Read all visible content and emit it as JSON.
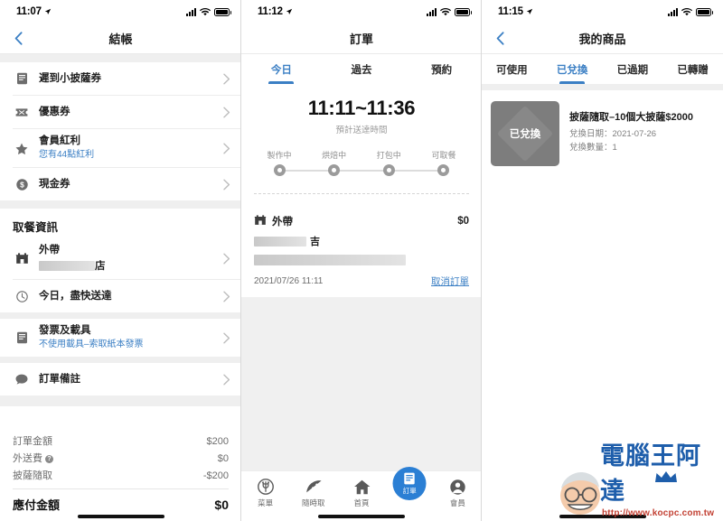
{
  "panel1": {
    "status": {
      "time": "11:07",
      "location_arrow": "location-arrow-icon",
      "signal": "signal-bars-icon",
      "wifi": "wifi-icon",
      "battery": "battery-icon"
    },
    "nav": {
      "back": "chevron-left-icon",
      "title": "結帳"
    },
    "coupons": [
      {
        "icon": "receipt-icon",
        "label": "遲到小披薩券",
        "sub": ""
      },
      {
        "icon": "ticket-icon",
        "label": "優惠券",
        "sub": ""
      },
      {
        "icon": "star-icon",
        "label": "會員紅利",
        "sub": "您有44點紅利"
      },
      {
        "icon": "dollar-circle-icon",
        "label": "現金券",
        "sub": ""
      }
    ],
    "pickup_section_title": "取餐資訊",
    "pickup": [
      {
        "icon": "store-icon",
        "label": "外帶",
        "sub_suffix": "店"
      },
      {
        "icon": "clock-icon",
        "label": "今日，盡快送達",
        "sub": ""
      }
    ],
    "invoice": {
      "icon": "receipt-icon",
      "label": "發票及載具",
      "sub": "不使用載具–索取紙本發票"
    },
    "note": {
      "icon": "comment-icon",
      "label": "訂單備註"
    },
    "totals": [
      {
        "label": "訂單金額",
        "value": "$200",
        "has_help": false
      },
      {
        "label": "外送費",
        "value": "$0",
        "has_help": true
      },
      {
        "label": "披薩隨取",
        "value": "-$200",
        "has_help": false
      }
    ],
    "total_final": {
      "label": "應付金額",
      "value": "$0"
    }
  },
  "panel2": {
    "status": {
      "time": "11:12"
    },
    "nav": {
      "title": "訂單"
    },
    "tabs": [
      {
        "label": "今日",
        "active": true
      },
      {
        "label": "過去",
        "active": false
      },
      {
        "label": "預約",
        "active": false
      }
    ],
    "eta": "11:11~11:36",
    "eta_sub": "預計送達時間",
    "steps": [
      "製作中",
      "烘焙中",
      "打包中",
      "可取餐"
    ],
    "order": {
      "type_icon": "store-icon",
      "type": "外帶",
      "price": "$0",
      "store_suffix": "吉",
      "datetime": "2021/07/26 11:11",
      "cancel_label": "取消訂單"
    },
    "bottom_nav": [
      {
        "icon": "menu-circle-icon",
        "label": "菜單",
        "active": false
      },
      {
        "icon": "pizza-slice-icon",
        "label": "隨時取",
        "active": false
      },
      {
        "icon": "home-icon",
        "label": "首頁",
        "active": false
      },
      {
        "icon": "order-list-icon",
        "label": "訂單",
        "active": true
      },
      {
        "icon": "user-icon",
        "label": "會員",
        "active": false
      }
    ]
  },
  "panel3": {
    "status": {
      "time": "11:15"
    },
    "nav": {
      "back": "chevron-left-icon",
      "title": "我的商品"
    },
    "tabs": [
      {
        "label": "可使用",
        "active": false
      },
      {
        "label": "已兌換",
        "active": true
      },
      {
        "label": "已過期",
        "active": false
      },
      {
        "label": "已轉贈",
        "active": false
      }
    ],
    "product": {
      "badge": "已兌換",
      "title": "披薩隨取–10個大披薩$2000",
      "meta1": "兌換日期：2021-07-26",
      "meta2": "兌換數量：1"
    }
  },
  "watermark": {
    "brand": "電腦王阿達",
    "url": "http://www.kocpc.com.tw"
  },
  "colors": {
    "accent": "#3b7fc4",
    "fab": "#2b7fd4",
    "thumb": "#7d7d7d",
    "muted": "#8e8e8e"
  }
}
